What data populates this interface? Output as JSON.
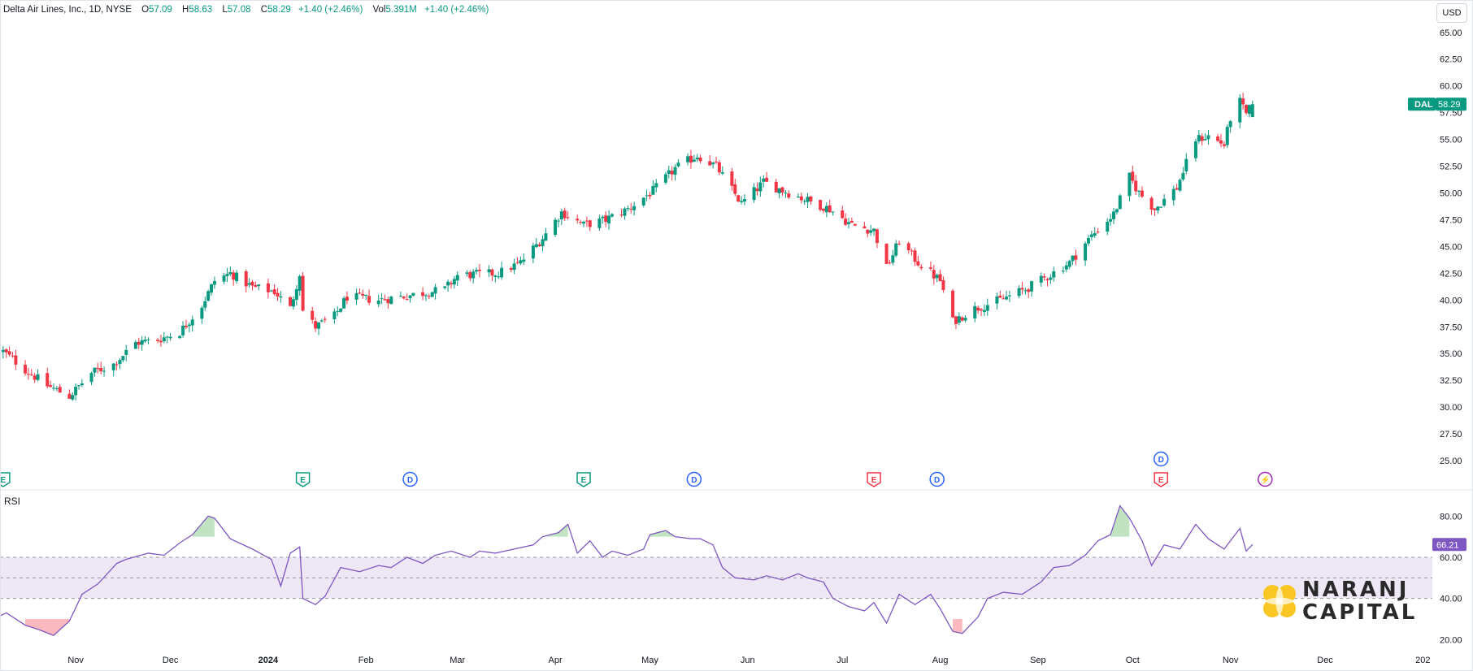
{
  "header": {
    "symbol_line": "Delta Air Lines, Inc., 1D, NYSE",
    "o_label": "O",
    "o": "57.09",
    "h_label": "H",
    "h": "58.63",
    "l_label": "L",
    "l": "57.08",
    "c_label": "C",
    "c": "58.29",
    "chg": "+1.40 (+2.46%)",
    "vol_label": "Vol",
    "vol": "5.391M",
    "vol_chg": "+1.40 (+2.46%)"
  },
  "currency": "USD",
  "rsi_title": "RSI",
  "price_badge": {
    "symbol": "DAL",
    "value": "58.29"
  },
  "rsi_badge": "66.21",
  "logo": {
    "line1": "NARANJ",
    "line2": "CAPITAL"
  },
  "colors": {
    "up": "#089981",
    "down": "#f23645",
    "rsi": "#7e57c2",
    "band": "#ede7f6"
  },
  "chart_data": [
    {
      "type": "candlestick",
      "ylim": [
        22.5,
        66.5
      ],
      "y_ticks": [
        "25.00",
        "27.50",
        "30.00",
        "32.50",
        "35.00",
        "37.50",
        "40.00",
        "42.50",
        "45.00",
        "47.50",
        "50.00",
        "52.50",
        "55.00",
        "57.50",
        "60.00",
        "62.50",
        "65.00"
      ],
      "x_ticks": [
        {
          "label": "Nov",
          "date": "2023-11-01"
        },
        {
          "label": "Dec",
          "date": "2023-12-01"
        },
        {
          "label": "2024",
          "date": "2024-01-01",
          "bold": true
        },
        {
          "label": "Feb",
          "date": "2024-02-01"
        },
        {
          "label": "Mar",
          "date": "2024-03-01"
        },
        {
          "label": "Apr",
          "date": "2024-04-01"
        },
        {
          "label": "May",
          "date": "2024-05-01"
        },
        {
          "label": "Jun",
          "date": "2024-06-01"
        },
        {
          "label": "Jul",
          "date": "2024-07-01"
        },
        {
          "label": "Aug",
          "date": "2024-08-01"
        },
        {
          "label": "Sep",
          "date": "2024-09-01"
        },
        {
          "label": "Oct",
          "date": "2024-10-01"
        },
        {
          "label": "Nov",
          "date": "2024-11-01"
        },
        {
          "label": "Dec",
          "date": "2024-12-01"
        },
        {
          "label": "202",
          "date": "2025-01-01"
        }
      ],
      "x_range": [
        "2023-10-08",
        "2025-01-04"
      ],
      "close_path": [
        [
          "2023-10-09",
          35.2
        ],
        [
          "2023-10-16",
          33.5
        ],
        [
          "2023-10-23",
          32.0
        ],
        [
          "2023-10-30",
          31.0
        ],
        [
          "2023-11-06",
          33.2
        ],
        [
          "2023-11-13",
          34.0
        ],
        [
          "2023-11-20",
          36.0
        ],
        [
          "2023-11-27",
          36.3
        ],
        [
          "2023-12-04",
          37.0
        ],
        [
          "2023-12-11",
          39.5
        ],
        [
          "2023-12-15",
          41.8
        ],
        [
          "2023-12-20",
          42.5
        ],
        [
          "2023-12-27",
          41.2
        ],
        [
          "2024-01-03",
          40.8
        ],
        [
          "2024-01-08",
          39.2
        ],
        [
          "2024-01-11",
          42.5
        ],
        [
          "2024-01-12",
          39.0
        ],
        [
          "2024-01-16",
          37.5
        ],
        [
          "2024-01-22",
          38.5
        ],
        [
          "2024-01-26",
          40.3
        ],
        [
          "2024-02-05",
          40.0
        ],
        [
          "2024-02-14",
          40.4
        ],
        [
          "2024-02-26",
          41.0
        ],
        [
          "2024-03-01",
          42.3
        ],
        [
          "2024-03-14",
          42.5
        ],
        [
          "2024-03-21",
          43.5
        ],
        [
          "2024-03-28",
          45.8
        ],
        [
          "2024-04-03",
          48.2
        ],
        [
          "2024-04-10",
          47.0
        ],
        [
          "2024-04-17",
          47.5
        ],
        [
          "2024-04-24",
          48.5
        ],
        [
          "2024-05-02",
          50.2
        ],
        [
          "2024-05-09",
          52.3
        ],
        [
          "2024-05-16",
          53.5
        ],
        [
          "2024-05-22",
          52.5
        ],
        [
          "2024-05-30",
          49.0
        ],
        [
          "2024-06-06",
          51.0
        ],
        [
          "2024-06-14",
          50.0
        ],
        [
          "2024-06-20",
          49.3
        ],
        [
          "2024-06-27",
          48.5
        ],
        [
          "2024-07-04",
          47.0
        ],
        [
          "2024-07-11",
          46.5
        ],
        [
          "2024-07-15",
          43.0
        ],
        [
          "2024-07-19",
          45.5
        ],
        [
          "2024-07-25",
          43.5
        ],
        [
          "2024-08-01",
          41.8
        ],
        [
          "2024-08-05",
          38.0
        ],
        [
          "2024-08-12",
          39.2
        ],
        [
          "2024-08-20",
          40.0
        ],
        [
          "2024-08-28",
          41.0
        ],
        [
          "2024-09-04",
          42.2
        ],
        [
          "2024-09-11",
          43.5
        ],
        [
          "2024-09-18",
          46.0
        ],
        [
          "2024-09-25",
          48.0
        ],
        [
          "2024-09-30",
          51.5
        ],
        [
          "2024-10-03",
          50.0
        ],
        [
          "2024-10-08",
          48.5
        ],
        [
          "2024-10-15",
          50.5
        ],
        [
          "2024-10-21",
          55.0
        ],
        [
          "2024-10-25",
          55.3
        ],
        [
          "2024-10-30",
          54.5
        ],
        [
          "2024-11-01",
          57.0
        ],
        [
          "2024-11-04",
          58.5
        ],
        [
          "2024-11-06",
          57.3
        ],
        [
          "2024-11-08",
          58.29
        ]
      ],
      "last_bar": {
        "date": "2024-11-08",
        "open": 57.09,
        "high": 58.63,
        "low": 57.08,
        "close": 58.29
      },
      "events": [
        {
          "date": "2023-10-09",
          "label": "E",
          "kind": "earnings",
          "color": "#089981"
        },
        {
          "date": "2024-01-12",
          "label": "E",
          "kind": "earnings",
          "color": "#089981"
        },
        {
          "date": "2024-02-15",
          "label": "D",
          "kind": "dividend",
          "color": "#2962ff"
        },
        {
          "date": "2024-04-10",
          "label": "E",
          "kind": "earnings",
          "color": "#089981"
        },
        {
          "date": "2024-05-15",
          "label": "D",
          "kind": "dividend",
          "color": "#2962ff"
        },
        {
          "date": "2024-07-11",
          "label": "E",
          "kind": "earnings",
          "color": "#f23645"
        },
        {
          "date": "2024-07-31",
          "label": "D",
          "kind": "dividend",
          "color": "#2962ff"
        },
        {
          "date": "2024-10-10",
          "label": "E",
          "kind": "earnings",
          "color": "#f23645"
        },
        {
          "date": "2024-10-10",
          "label": "D",
          "kind": "dividend",
          "color": "#2962ff",
          "stack": 1
        },
        {
          "date": "2024-11-12",
          "label": "⚡",
          "kind": "split",
          "color": "#9c27b0"
        }
      ]
    },
    {
      "type": "line",
      "title": "RSI",
      "ylim": [
        15,
        90
      ],
      "y_ticks": [
        "20.00",
        "40.00",
        "60.00",
        "80.00"
      ],
      "bands": {
        "upper": 60,
        "middle": 50,
        "lower": 40
      },
      "last_value": 66.21,
      "points": [
        [
          "2023-10-06",
          30
        ],
        [
          "2023-10-10",
          33
        ],
        [
          "2023-10-16",
          27
        ],
        [
          "2023-10-20",
          25
        ],
        [
          "2023-10-25",
          22
        ],
        [
          "2023-10-30",
          29
        ],
        [
          "2023-11-03",
          42
        ],
        [
          "2023-11-08",
          47
        ],
        [
          "2023-11-14",
          57
        ],
        [
          "2023-11-17",
          59
        ],
        [
          "2023-11-24",
          62
        ],
        [
          "2023-11-29",
          61
        ],
        [
          "2023-12-04",
          67
        ],
        [
          "2023-12-08",
          71
        ],
        [
          "2023-12-13",
          80
        ],
        [
          "2023-12-15",
          79
        ],
        [
          "2023-12-20",
          69
        ],
        [
          "2023-12-27",
          64
        ],
        [
          "2024-01-02",
          59
        ],
        [
          "2024-01-05",
          46
        ],
        [
          "2024-01-08",
          62
        ],
        [
          "2024-01-11",
          65
        ],
        [
          "2024-01-12",
          40
        ],
        [
          "2024-01-16",
          37
        ],
        [
          "2024-01-19",
          41
        ],
        [
          "2024-01-24",
          55
        ],
        [
          "2024-01-30",
          53
        ],
        [
          "2024-02-05",
          56
        ],
        [
          "2024-02-09",
          55
        ],
        [
          "2024-02-14",
          60
        ],
        [
          "2024-02-19",
          57
        ],
        [
          "2024-02-23",
          61
        ],
        [
          "2024-02-28",
          63
        ],
        [
          "2024-03-05",
          60
        ],
        [
          "2024-03-08",
          63
        ],
        [
          "2024-03-13",
          62
        ],
        [
          "2024-03-19",
          64
        ],
        [
          "2024-03-25",
          66
        ],
        [
          "2024-03-28",
          70
        ],
        [
          "2024-04-02",
          72
        ],
        [
          "2024-04-05",
          76
        ],
        [
          "2024-04-08",
          62
        ],
        [
          "2024-04-12",
          68
        ],
        [
          "2024-04-16",
          60
        ],
        [
          "2024-04-19",
          63
        ],
        [
          "2024-04-24",
          61
        ],
        [
          "2024-04-29",
          64
        ],
        [
          "2024-05-01",
          71
        ],
        [
          "2024-05-06",
          73
        ],
        [
          "2024-05-09",
          70
        ],
        [
          "2024-05-14",
          69
        ],
        [
          "2024-05-17",
          69
        ],
        [
          "2024-05-21",
          66
        ],
        [
          "2024-05-24",
          55
        ],
        [
          "2024-05-28",
          50
        ],
        [
          "2024-06-03",
          49
        ],
        [
          "2024-06-07",
          51
        ],
        [
          "2024-06-12",
          49
        ],
        [
          "2024-06-17",
          52
        ],
        [
          "2024-06-20",
          50
        ],
        [
          "2024-06-25",
          48
        ],
        [
          "2024-06-28",
          40
        ],
        [
          "2024-07-03",
          36
        ],
        [
          "2024-07-08",
          34
        ],
        [
          "2024-07-11",
          38
        ],
        [
          "2024-07-15",
          28
        ],
        [
          "2024-07-19",
          42
        ],
        [
          "2024-07-24",
          37
        ],
        [
          "2024-07-29",
          42
        ],
        [
          "2024-08-01",
          35
        ],
        [
          "2024-08-05",
          24
        ],
        [
          "2024-08-08",
          23
        ],
        [
          "2024-08-13",
          31
        ],
        [
          "2024-08-16",
          40
        ],
        [
          "2024-08-21",
          43
        ],
        [
          "2024-08-27",
          42
        ],
        [
          "2024-09-02",
          48
        ],
        [
          "2024-09-06",
          55
        ],
        [
          "2024-09-11",
          56
        ],
        [
          "2024-09-16",
          61
        ],
        [
          "2024-09-20",
          68
        ],
        [
          "2024-09-24",
          71
        ],
        [
          "2024-09-27",
          85
        ],
        [
          "2024-09-30",
          79
        ],
        [
          "2024-10-04",
          68
        ],
        [
          "2024-10-07",
          56
        ],
        [
          "2024-10-11",
          66
        ],
        [
          "2024-10-16",
          64
        ],
        [
          "2024-10-21",
          76
        ],
        [
          "2024-10-25",
          69
        ],
        [
          "2024-10-30",
          64
        ],
        [
          "2024-11-04",
          74
        ],
        [
          "2024-11-06",
          63
        ],
        [
          "2024-11-08",
          66.21
        ]
      ]
    }
  ]
}
